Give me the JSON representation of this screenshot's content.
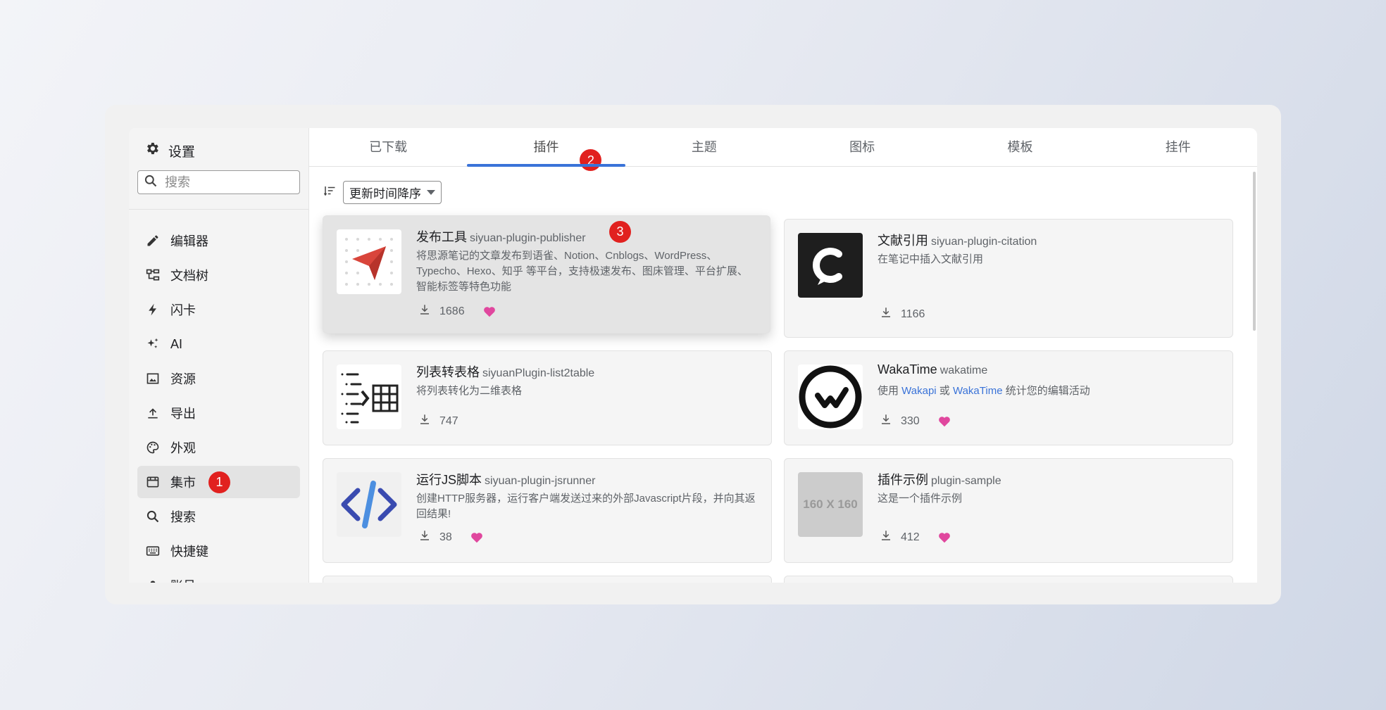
{
  "sidebar": {
    "title": "设置",
    "search_placeholder": "搜索",
    "items": [
      {
        "label": "编辑器",
        "icon": "pencil-icon"
      },
      {
        "label": "文档树",
        "icon": "tree-icon"
      },
      {
        "label": "闪卡",
        "icon": "flash-icon"
      },
      {
        "label": "AI",
        "icon": "sparkle-icon"
      },
      {
        "label": "资源",
        "icon": "image-icon"
      },
      {
        "label": "导出",
        "icon": "upload-icon"
      },
      {
        "label": "外观",
        "icon": "palette-icon"
      },
      {
        "label": "集市",
        "icon": "store-icon",
        "active": true
      },
      {
        "label": "搜索",
        "icon": "search-icon"
      },
      {
        "label": "快捷键",
        "icon": "keyboard-icon"
      },
      {
        "label": "账号",
        "icon": "account-icon"
      }
    ]
  },
  "tabs": [
    {
      "label": "已下载"
    },
    {
      "label": "插件",
      "active": true
    },
    {
      "label": "主题"
    },
    {
      "label": "图标"
    },
    {
      "label": "模板"
    },
    {
      "label": "挂件"
    }
  ],
  "sort": {
    "label": "更新时间降序"
  },
  "badges": {
    "b1": "1",
    "b2": "2",
    "b3": "3"
  },
  "cards": [
    {
      "name": "发布工具",
      "package": "siyuan-plugin-publisher",
      "desc": "将思源笔记的文章发布到语雀、Notion、Cnblogs、WordPress、Typecho、Hexo、知乎 等平台，支持极速发布、图床管理、平台扩展、智能标签等特色功能",
      "downloads": "1686",
      "liked": true
    },
    {
      "name": "文献引用",
      "package": "siyuan-plugin-citation",
      "desc": "在笔记中插入文献引用",
      "downloads": "1166",
      "liked": false
    },
    {
      "name": "列表转表格",
      "package": "siyuanPlugin-list2table",
      "desc": "将列表转化为二维表格",
      "downloads": "747",
      "liked": false
    },
    {
      "name": "WakaTime",
      "package": "wakatime",
      "desc_parts": {
        "pre": "使用 ",
        "link1": "Wakapi",
        "mid": " 或 ",
        "link2": "WakaTime",
        "post": " 统计您的编辑活动"
      },
      "downloads": "330",
      "liked": true
    },
    {
      "name": "运行JS脚本",
      "package": "siyuan-plugin-jsrunner",
      "desc": "创建HTTP服务器，运行客户端发送过来的外部Javascript片段，并向其返回结果!",
      "downloads": "38",
      "liked": true
    },
    {
      "name": "插件示例",
      "package": "plugin-sample",
      "desc": "这是一个插件示例",
      "downloads": "412",
      "liked": true,
      "thumb_text": "160 X 160"
    }
  ],
  "colors": {
    "accent": "#3a73d8",
    "badge": "#e1211f",
    "heart": "#e0479e"
  }
}
